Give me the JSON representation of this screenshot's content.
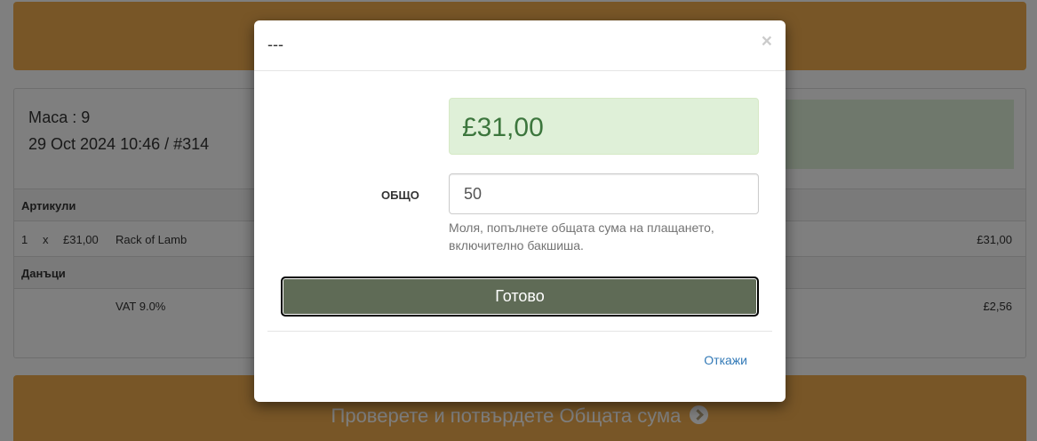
{
  "page": {
    "table_label": "Маса : 9",
    "order_info": "29 Oct 2024 10:46 / #314",
    "sections": {
      "items_header": "Артикули",
      "taxes_header": "Данъци"
    },
    "item": {
      "qty": "1",
      "x": "x",
      "unit_price": "£31,00",
      "name": "Rack of Lamb",
      "total": "£31,00"
    },
    "tax": {
      "label": "VAT 9.0%",
      "amount": "£2,56"
    },
    "confirm_bar": "Проверете и потвърдете Общата сума"
  },
  "modal": {
    "title": "---",
    "close": "×",
    "total_amount": "£31,00",
    "field_label": "ОБЩО",
    "input_value": "50",
    "help_text": "Моля, попълнете общата сума на плащането, включително бакшиша.",
    "done_label": "Готово",
    "cancel_label": "Откажи"
  },
  "colors": {
    "warning_bar": "#f0ad4e",
    "success_bg": "#dff0d8",
    "success_text": "#3c763d",
    "done_button": "#5f6b56",
    "link": "#337ab7"
  },
  "icons": {
    "confirm_bar_icon": "chevron-circle-right-icon",
    "close_icon": "close-icon"
  }
}
